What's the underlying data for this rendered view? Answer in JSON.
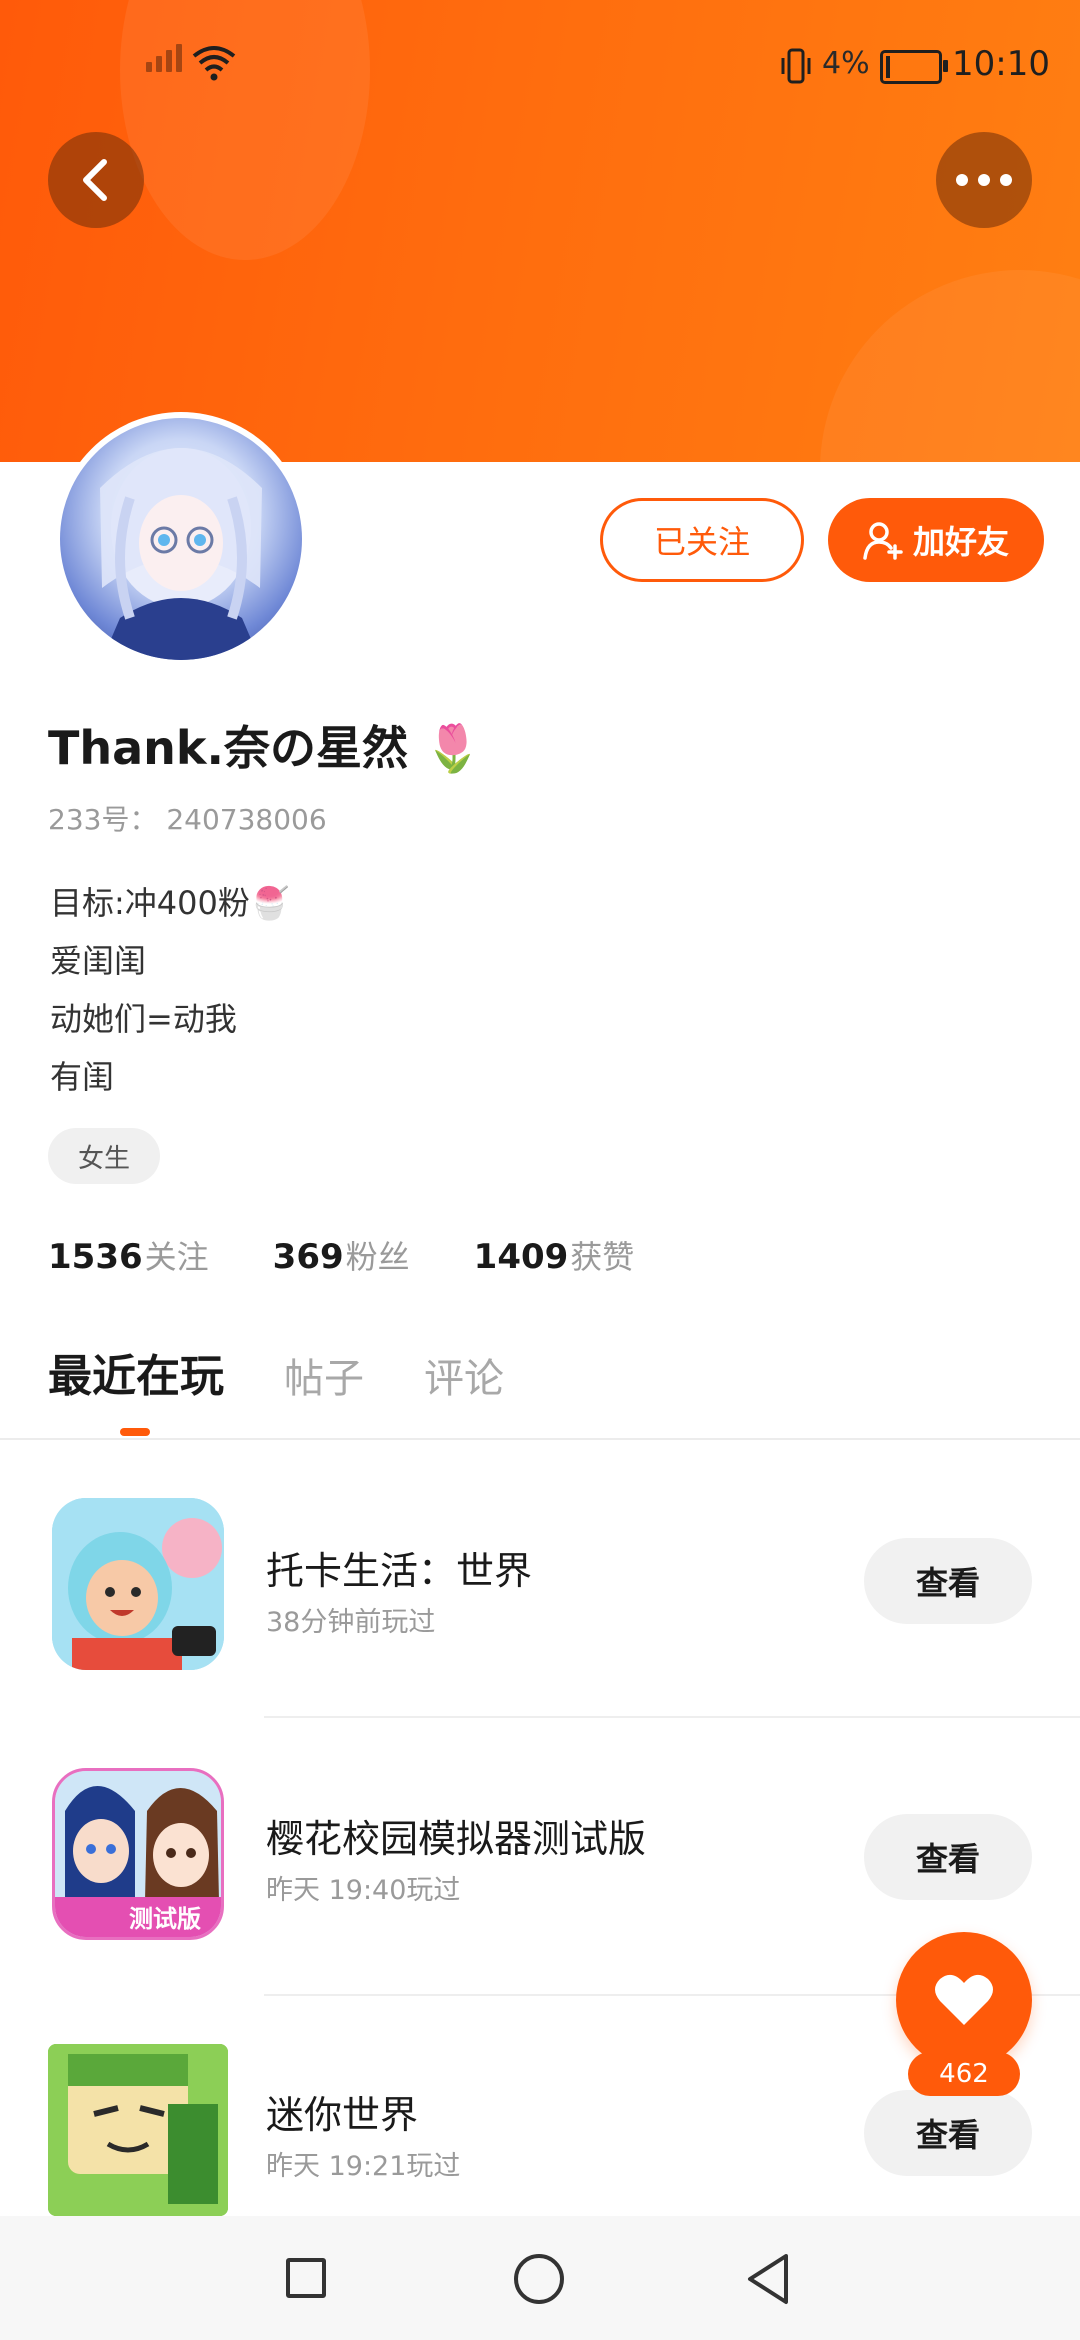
{
  "status_bar": {
    "battery_percent": "4%",
    "time": "10:10"
  },
  "header": {
    "back_label": "back",
    "more_label": "more"
  },
  "profile": {
    "followed_button": "已关注",
    "add_friend_button": "加好友",
    "username": "Thank.奈の星然",
    "username_emoji": "🌷",
    "uid": "233号： 240738006",
    "bio": [
      "目标:冲400粉🍧",
      "爱闺闺",
      "动她们=动我",
      "有闺"
    ],
    "gender_tag": "女生",
    "stats": [
      {
        "num": "1536",
        "label": "关注"
      },
      {
        "num": "369",
        "label": "粉丝"
      },
      {
        "num": "1409",
        "label": "获赞"
      }
    ]
  },
  "tabs": [
    {
      "label": "最近在玩",
      "active": true
    },
    {
      "label": "帖子",
      "active": false
    },
    {
      "label": "评论",
      "active": false
    }
  ],
  "games": [
    {
      "title": "托卡生活：世界",
      "subtitle": "38分钟前玩过",
      "button": "查看"
    },
    {
      "title": "樱花校园模拟器测试版",
      "subtitle": "昨天 19:40玩过",
      "button": "查看",
      "badge": "测试版"
    },
    {
      "title": "迷你世界",
      "subtitle": "昨天 19:21玩过",
      "button": "查看"
    }
  ],
  "fab": {
    "count": "462"
  },
  "colors": {
    "accent": "#ff5a0a",
    "banner_end": "#ff7f12"
  }
}
